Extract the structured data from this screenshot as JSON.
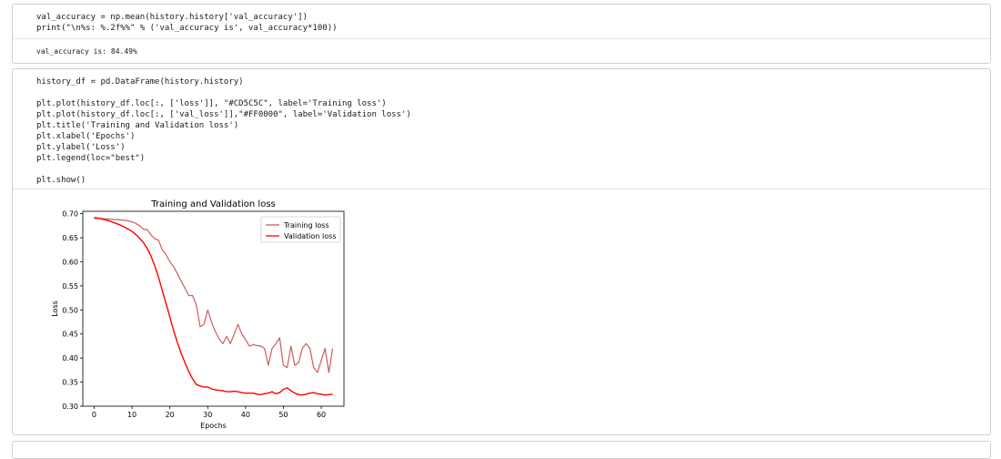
{
  "cell1": {
    "code_lines": [
      "val_accuracy = np.mean(history.history['val_accuracy'])",
      "print(\"\\n%s: %.2f%%\" % ('val_accuracy is', val_accuracy*100))"
    ],
    "output": "val_accuracy is: 84.49%"
  },
  "cell2": {
    "code_lines": [
      "history_df = pd.DataFrame(history.history)",
      "",
      "plt.plot(history_df.loc[:, ['loss']], \"#CD5C5C\", label='Training loss')",
      "plt.plot(history_df.loc[:, ['val_loss']],\"#FF0000\", label='Validation loss')",
      "plt.title('Training and Validation loss')",
      "plt.xlabel('Epochs')",
      "plt.ylabel('Loss')",
      "plt.legend(loc=\"best\")",
      "",
      "plt.show()"
    ]
  },
  "chart_data": {
    "type": "line",
    "title": "Training and Validation loss",
    "xlabel": "Epochs",
    "ylabel": "Loss",
    "xlim": [
      -3,
      66
    ],
    "ylim": [
      0.3,
      0.705
    ],
    "xticks": [
      0,
      10,
      20,
      30,
      40,
      50,
      60
    ],
    "yticks": [
      0.3,
      0.35,
      0.4,
      0.45,
      0.5,
      0.55,
      0.6,
      0.65,
      0.7
    ],
    "legend_position": "top-right",
    "grid": false,
    "series": [
      {
        "name": "Training loss",
        "color": "#CD5C5C",
        "x": [
          0,
          1,
          2,
          3,
          4,
          5,
          6,
          7,
          8,
          9,
          10,
          11,
          12,
          13,
          14,
          15,
          16,
          17,
          18,
          19,
          20,
          21,
          22,
          23,
          24,
          25,
          26,
          27,
          28,
          29,
          30,
          31,
          32,
          33,
          34,
          35,
          36,
          37,
          38,
          39,
          40,
          41,
          42,
          43,
          44,
          45,
          46,
          47,
          48,
          49,
          50,
          51,
          52,
          53,
          54,
          55,
          56,
          57,
          58,
          59,
          60,
          61,
          62,
          63
        ],
        "y": [
          0.69,
          0.69,
          0.69,
          0.689,
          0.689,
          0.688,
          0.688,
          0.687,
          0.686,
          0.685,
          0.683,
          0.68,
          0.675,
          0.668,
          0.667,
          0.656,
          0.648,
          0.645,
          0.625,
          0.615,
          0.6,
          0.59,
          0.575,
          0.56,
          0.545,
          0.53,
          0.53,
          0.51,
          0.465,
          0.47,
          0.5,
          0.475,
          0.455,
          0.44,
          0.43,
          0.445,
          0.43,
          0.45,
          0.47,
          0.45,
          0.438,
          0.425,
          0.428,
          0.426,
          0.425,
          0.42,
          0.385,
          0.42,
          0.43,
          0.442,
          0.385,
          0.38,
          0.425,
          0.385,
          0.39,
          0.42,
          0.43,
          0.42,
          0.38,
          0.37,
          0.395,
          0.42,
          0.37,
          0.42
        ]
      },
      {
        "name": "Validation loss",
        "color": "#FF0000",
        "x": [
          0,
          1,
          2,
          3,
          4,
          5,
          6,
          7,
          8,
          9,
          10,
          11,
          12,
          13,
          14,
          15,
          16,
          17,
          18,
          19,
          20,
          21,
          22,
          23,
          24,
          25,
          26,
          27,
          28,
          29,
          30,
          31,
          32,
          33,
          34,
          35,
          36,
          37,
          38,
          39,
          40,
          41,
          42,
          43,
          44,
          45,
          46,
          47,
          48,
          49,
          50,
          51,
          52,
          53,
          54,
          55,
          56,
          57,
          58,
          59,
          60,
          61,
          62,
          63
        ],
        "y": [
          0.692,
          0.691,
          0.689,
          0.687,
          0.685,
          0.682,
          0.679,
          0.676,
          0.672,
          0.668,
          0.663,
          0.657,
          0.649,
          0.64,
          0.628,
          0.612,
          0.592,
          0.568,
          0.541,
          0.513,
          0.485,
          0.457,
          0.432,
          0.41,
          0.39,
          0.372,
          0.357,
          0.345,
          0.342,
          0.34,
          0.34,
          0.336,
          0.334,
          0.333,
          0.332,
          0.33,
          0.33,
          0.331,
          0.33,
          0.328,
          0.327,
          0.327,
          0.327,
          0.325,
          0.324,
          0.326,
          0.327,
          0.33,
          0.326,
          0.328,
          0.335,
          0.338,
          0.332,
          0.327,
          0.324,
          0.323,
          0.325,
          0.327,
          0.328,
          0.326,
          0.325,
          0.323,
          0.324,
          0.325
        ]
      }
    ]
  }
}
